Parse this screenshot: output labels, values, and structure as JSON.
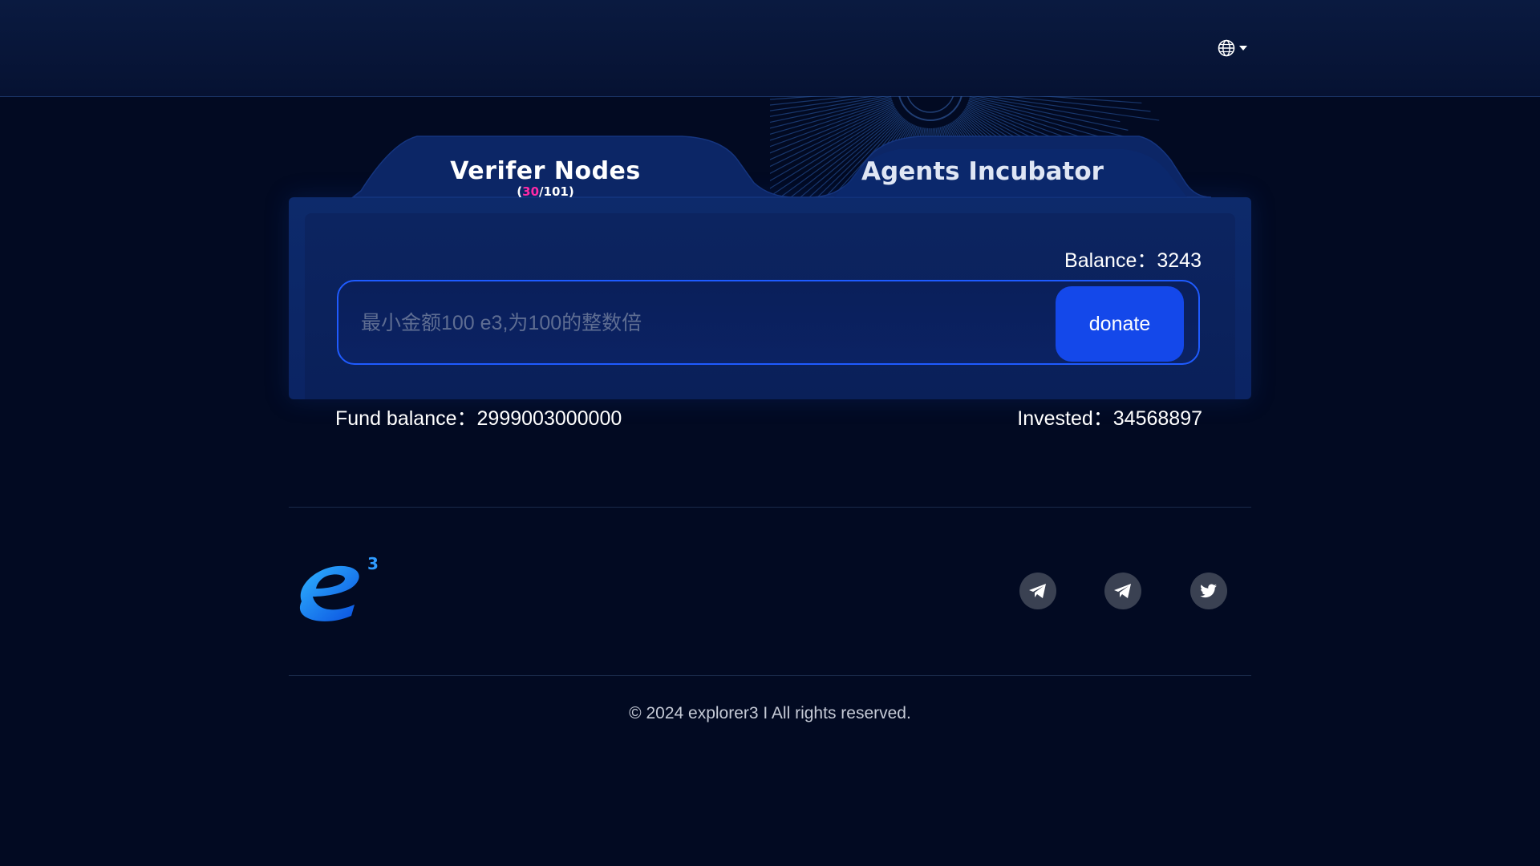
{
  "header": {
    "language_icon": "globe-icon",
    "dropdown_icon": "caret-down-icon"
  },
  "tabs": [
    {
      "label": "Verifer Nodes",
      "count_open": "(",
      "count_current": "30",
      "count_sep": "/101",
      "count_close": ")"
    },
    {
      "label": "Agents Incubator"
    }
  ],
  "donate": {
    "balance_label": "Balance：",
    "balance_value": "3243",
    "placeholder": "最小金额100 e3,为100的整数倍",
    "button_label": "donate"
  },
  "stats": {
    "fund_label": "Fund balance：",
    "fund_value": "2999003000000",
    "invested_label": "Invested：",
    "invested_value": "34568897"
  },
  "footer": {
    "logo_icon": "e3-logo-icon",
    "social": [
      "telegram-icon",
      "telegram-icon",
      "twitter-icon"
    ],
    "copyright": "© 2024 explorer3 I All rights reserved."
  },
  "colors": {
    "accent": "#1448ea",
    "highlight": "#ff2aa6",
    "background": "#020a22"
  }
}
